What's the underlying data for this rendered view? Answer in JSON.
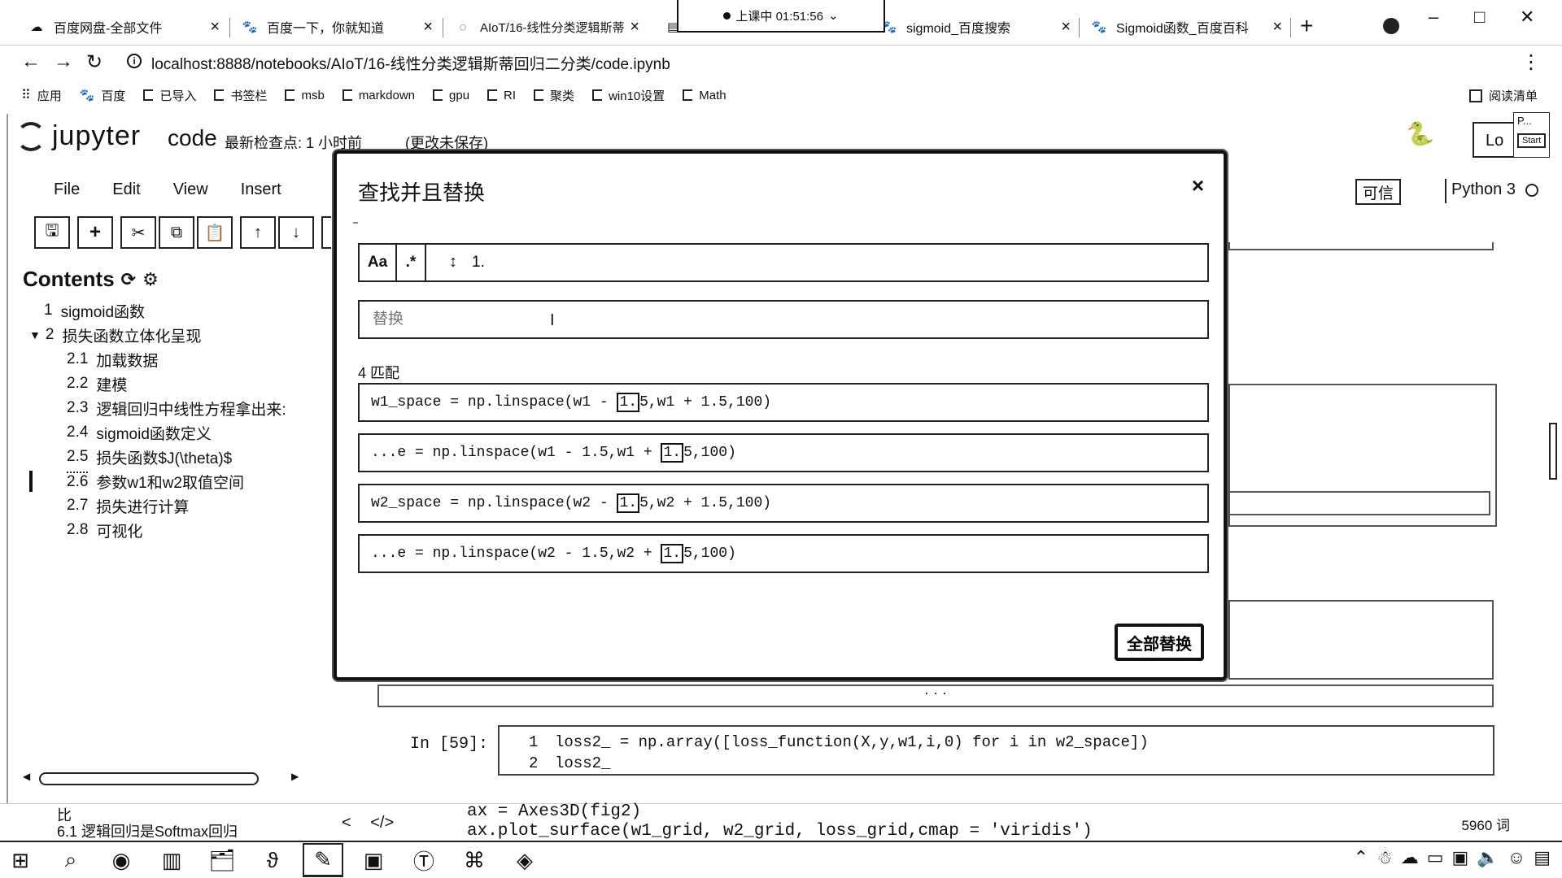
{
  "browser": {
    "tabs": [
      {
        "title": "百度网盘-全部文件",
        "icon": "cloud-icon"
      },
      {
        "title": "百度一下，你就知道",
        "icon": "baidu-paw-icon"
      },
      {
        "title": "AIoT/16-线性分类逻辑斯蒂",
        "icon": "loading-icon"
      },
      {
        "title": "",
        "icon": "notebook-icon"
      },
      {
        "title": "sigmoid_百度搜索",
        "icon": "baidu-paw-icon"
      },
      {
        "title": "Sigmoid函数_百度百科",
        "icon": "baidu-paw-icon"
      }
    ],
    "tab_close": "×",
    "new_tab": "+",
    "timer": "上课中 01:51:56",
    "timer_caret": "⌄",
    "window_controls": {
      "minimize": "–",
      "maximize": "□",
      "close": "✕"
    },
    "url": "localhost:8888/notebooks/AIoT/16-线性分类逻辑斯蒂回归二分类/code.ipynb",
    "nav": {
      "back": "←",
      "forward": "→",
      "reload": "↻",
      "menu": "⋮"
    },
    "bookmarks": [
      "应用",
      "百度",
      "已导入",
      "书签栏",
      "msb",
      "markdown",
      "gpu",
      "RI",
      "聚类",
      "win10设置",
      "Math"
    ],
    "reading_list": "阅读清单"
  },
  "jupyter": {
    "logo_text": "jupyter",
    "notebook_name": "code",
    "checkpoint": "最新检查点: 1 小时前",
    "unsaved": "(更改未保存)",
    "logout": "Lo",
    "panel_title": "P...",
    "panel_start": "Start",
    "menus": [
      "File",
      "Edit",
      "View",
      "Insert"
    ],
    "toolbar": [
      "save-icon",
      "add-icon",
      "cut-icon",
      "copy-icon",
      "paste-icon",
      "move-up-icon",
      "move-down-icon"
    ],
    "trusted": "可信",
    "kernel": "Python 3"
  },
  "toc": {
    "title": "Contents",
    "items": [
      {
        "num": "1",
        "label": "sigmoid函数",
        "level": 1
      },
      {
        "num": "2",
        "label": "损失函数立体化呈现",
        "level": 1,
        "expanded": true
      },
      {
        "num": "2.1",
        "label": "加载数据",
        "level": 2
      },
      {
        "num": "2.2",
        "label": "建模",
        "level": 2
      },
      {
        "num": "2.3",
        "label": "逻辑回归中线性方程拿出来:",
        "level": 2
      },
      {
        "num": "2.4",
        "label": "sigmoid函数定义",
        "level": 2
      },
      {
        "num": "2.5",
        "label": "损失函数$J(\\theta)$",
        "level": 2
      },
      {
        "num": "2.6",
        "label": "参数w1和w2取值空间",
        "level": 2,
        "active": true
      },
      {
        "num": "2.7",
        "label": "损失进行计算",
        "level": 2
      },
      {
        "num": "2.8",
        "label": "可视化",
        "level": 2
      }
    ]
  },
  "notebook": {
    "ellipsis": "· · ·",
    "in_label": "In  [59]:",
    "cell_lines": [
      {
        "n": "1",
        "code": "loss2_ = np.array([loss_function(X,y,w1,i,0) for i in w2_space])"
      },
      {
        "n": "2",
        "code": "loss2_"
      }
    ],
    "partial_code_1": "ax = Axes3D(fig2)",
    "partial_code_2": "ax.plot_surface(w1_grid, w2_grid, loss_grid,cmap = 'viridis')",
    "partial_toc": "6.1  逻辑回归是Softmax回归",
    "partial_toc_top": "比",
    "word_count": "5960 词",
    "nav_prev": "<",
    "nav_code": "</>"
  },
  "modal": {
    "title": "查找并且替换",
    "close": "×",
    "opt_case": "Aa",
    "opt_regex": ".*",
    "opt_selection": "↕",
    "find_value": "1.",
    "replace_placeholder": "替换",
    "match_count": "4 匹配",
    "matches": [
      {
        "before": "w1_space = np.linspace(w1 - ",
        "hit": "1.",
        "after": "5,w1 + 1.5,100)"
      },
      {
        "before": "...e = np.linspace(w1 - 1.5,w1 + ",
        "hit": "1.",
        "after": "5,100)"
      },
      {
        "before": "w2_space = np.linspace(w2 - ",
        "hit": "1.",
        "after": "5,w2 + 1.5,100)"
      },
      {
        "before": "...e = np.linspace(w2 - 1.5,w2 + ",
        "hit": "1.",
        "after": "5,100)"
      }
    ],
    "replace_all": "全部替换"
  },
  "taskbar": {
    "items": [
      "windows-start-icon",
      "search-icon",
      "cortana-icon",
      "task-view-icon",
      "file-explorer-icon",
      "app-icon",
      "pen-tool-icon",
      "screen-capture-icon",
      "typora-icon",
      "python-app-icon",
      "cube-app-icon"
    ],
    "tray": [
      "chevron-up-icon",
      "snowman-icon",
      "cloud-icon",
      "battery-icon",
      "display-icon",
      "volume-icon",
      "ime-icon",
      "notification-icon"
    ]
  }
}
